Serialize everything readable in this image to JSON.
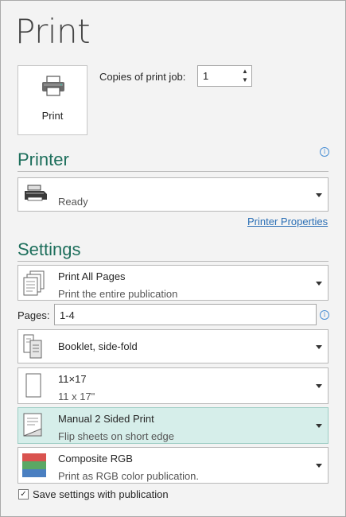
{
  "title": "Print",
  "print_button": {
    "label": "Print"
  },
  "copies": {
    "label": "Copies of print job:",
    "value": "1"
  },
  "printer": {
    "heading": "Printer",
    "status": "Ready",
    "properties_link": "Printer Properties"
  },
  "settings": {
    "heading": "Settings",
    "range": {
      "title": "Print All Pages",
      "subtitle": "Print the entire publication"
    },
    "pages": {
      "label": "Pages:",
      "value": "1-4"
    },
    "layout": {
      "title": "Booklet, side-fold"
    },
    "paper": {
      "title": "11×17",
      "subtitle": "11 x 17\""
    },
    "sides": {
      "title": "Manual 2 Sided Print",
      "subtitle": "Flip sheets on short edge"
    },
    "color": {
      "title": "Composite RGB",
      "subtitle": "Print as RGB color publication."
    },
    "save": {
      "label": "Save settings with publication",
      "checked": true
    }
  },
  "colors": {
    "accent": "#1e6f5c",
    "highlight": "#d6eeea",
    "link": "#2b6fb5"
  }
}
